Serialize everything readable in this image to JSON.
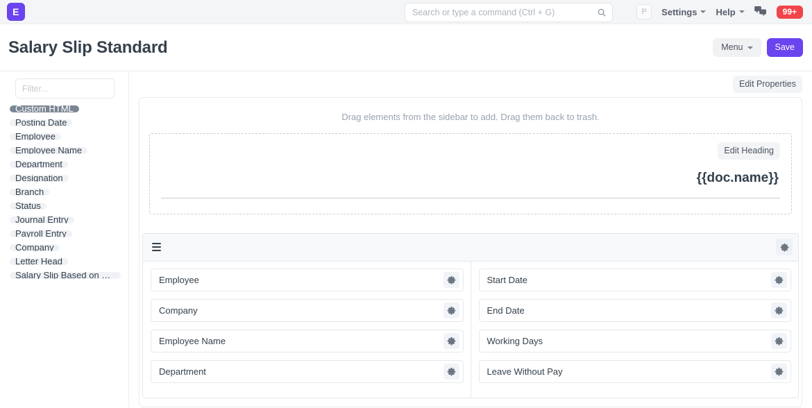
{
  "navbar": {
    "brand_letter": "E",
    "search": {
      "placeholder": "Search or type a command (Ctrl + G)",
      "value": "",
      "icon": "search-icon"
    },
    "avatar_letter": "P",
    "settings_label": "Settings",
    "help_label": "Help",
    "chat_icon": "chat-bubbles-icon",
    "notification_count": "99+",
    "colors": {
      "brand_bg": "#6a44ee",
      "navbar_bg": "#f4f5f6",
      "badge_bg": "#f2444b"
    }
  },
  "page": {
    "title": "Salary Slip Standard",
    "menu_label": "Menu",
    "save_label": "Save",
    "primary_color": "#6a44ee"
  },
  "sidebar": {
    "filter": {
      "placeholder": "Filter...",
      "value": ""
    },
    "fields": [
      {
        "label": "Custom HTML",
        "active": true
      },
      {
        "label": "Posting Date",
        "active": false
      },
      {
        "label": "Employee",
        "active": false
      },
      {
        "label": "Employee Name",
        "active": false
      },
      {
        "label": "Department",
        "active": false
      },
      {
        "label": "Designation",
        "active": false
      },
      {
        "label": "Branch",
        "active": false
      },
      {
        "label": "Status",
        "active": false
      },
      {
        "label": "Journal Entry",
        "active": false
      },
      {
        "label": "Payroll Entry",
        "active": false
      },
      {
        "label": "Company",
        "active": false
      },
      {
        "label": "Letter Head",
        "active": false
      },
      {
        "label": "Salary Slip Based on Tim…",
        "active": false
      }
    ]
  },
  "main": {
    "edit_properties_label": "Edit Properties",
    "drag_hint": "Drag elements from the sidebar to add. Drag them back to trash.",
    "heading_block": {
      "edit_heading_label": "Edit Heading",
      "title": "{{doc.name}}"
    },
    "section": {
      "drag_handle_icon": "hamburger-icon",
      "settings_icon": "gear-icon",
      "columns": [
        {
          "rows": [
            {
              "label": "Employee"
            },
            {
              "label": "Company"
            },
            {
              "label": "Employee Name"
            },
            {
              "label": "Department"
            }
          ]
        },
        {
          "rows": [
            {
              "label": "Start Date"
            },
            {
              "label": "End Date"
            },
            {
              "label": "Working Days"
            },
            {
              "label": "Leave Without Pay"
            }
          ]
        }
      ]
    }
  }
}
